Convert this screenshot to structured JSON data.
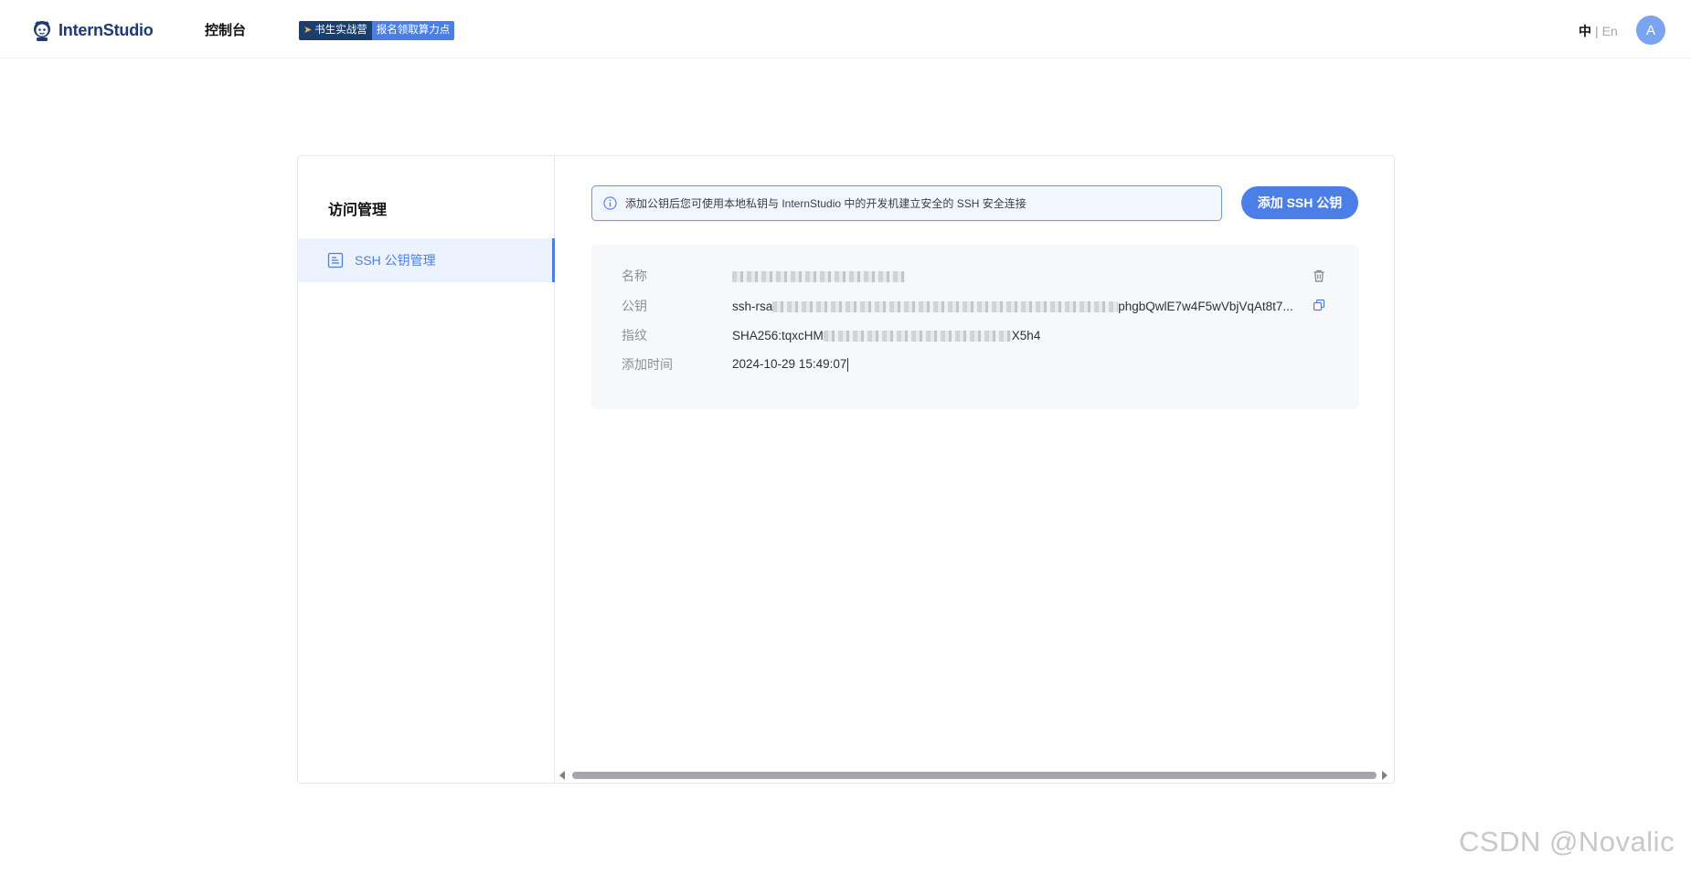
{
  "header": {
    "brand": "InternStudio",
    "nav_console": "控制台",
    "promo": {
      "left": "书生实战营",
      "right": "报名领取算力点"
    },
    "lang": {
      "zh": "中",
      "separator": "|",
      "en": "En"
    },
    "avatar_initial": "A"
  },
  "sidebar": {
    "title": "访问管理",
    "items": [
      {
        "label": "SSH 公钥管理",
        "icon": "document-icon",
        "active": true
      }
    ]
  },
  "main": {
    "notice": "添加公钥后您可使用本地私钥与 InternStudio 中的开发机建立安全的 SSH 安全连接",
    "add_button": "添加 SSH 公钥",
    "key": {
      "name_label": "名称",
      "pubkey_label": "公钥",
      "pubkey_prefix": "ssh-rsa",
      "pubkey_suffix": "phgbQwlE7w4F5wVbjVqAt8t7...",
      "fingerprint_label": "指纹",
      "fingerprint_prefix": "SHA256:tqxcHM",
      "fingerprint_suffix": "X5h4",
      "added_label": "添加时间",
      "added_value": "2024-10-29 15:49:07"
    }
  },
  "watermark": "CSDN @Novalic",
  "colors": {
    "accent": "#4c7ee8",
    "brand": "#1d3a73",
    "active_bg": "#edf3fe"
  }
}
